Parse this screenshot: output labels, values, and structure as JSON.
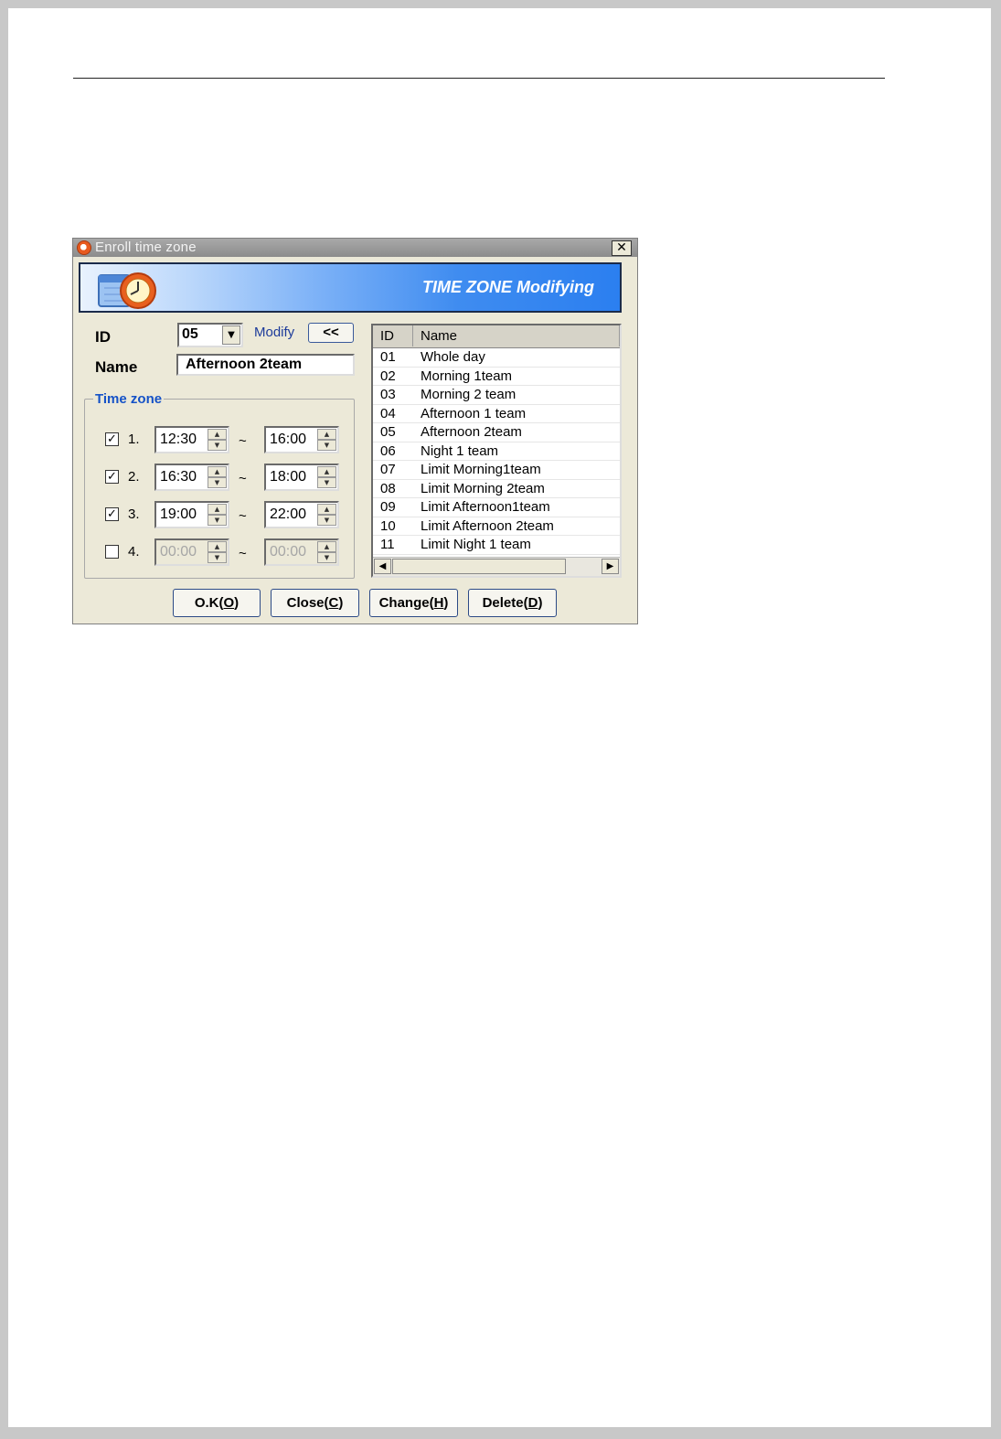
{
  "window": {
    "title": "Enroll time zone",
    "close_glyph": "✕"
  },
  "banner": {
    "title": "TIME ZONE Modifying",
    "icon": "clock-calendar-icon"
  },
  "form": {
    "id_label": "ID",
    "id_value": "05",
    "modify_label": "Modify",
    "modify_button": "<<",
    "name_label": "Name",
    "name_value": "Afternoon 2team"
  },
  "time_zone": {
    "legend": "Time zone",
    "separator": "~",
    "rows": [
      {
        "num": "1.",
        "checked": true,
        "start": "12:30",
        "end": "16:00",
        "enabled": true
      },
      {
        "num": "2.",
        "checked": true,
        "start": "16:30",
        "end": "18:00",
        "enabled": true
      },
      {
        "num": "3.",
        "checked": true,
        "start": "19:00",
        "end": "22:00",
        "enabled": true
      },
      {
        "num": "4.",
        "checked": false,
        "start": "00:00",
        "end": "00:00",
        "enabled": false
      }
    ]
  },
  "list": {
    "columns": [
      "ID",
      "Name"
    ],
    "rows": [
      [
        "01",
        "Whole day"
      ],
      [
        "02",
        "Morning 1team"
      ],
      [
        "03",
        "Morning 2 team"
      ],
      [
        "04",
        "Afternoon 1 team"
      ],
      [
        "05",
        "Afternoon 2team"
      ],
      [
        "06",
        "Night 1 team"
      ],
      [
        "07",
        "Limit Morning1team"
      ],
      [
        "08",
        "Limit Morning 2team"
      ],
      [
        "09",
        "Limit Afternoon1team"
      ],
      [
        "10",
        "Limit Afternoon 2team"
      ],
      [
        "11",
        "Limit Night 1 team"
      ]
    ]
  },
  "buttons": [
    {
      "label": "O.K(",
      "key": "O",
      "end": ")"
    },
    {
      "label": "Close(",
      "key": "C",
      "end": ")"
    },
    {
      "label": "Change(",
      "key": "H",
      "end": ")"
    },
    {
      "label": "Delete(",
      "key": "D",
      "end": ")"
    }
  ]
}
